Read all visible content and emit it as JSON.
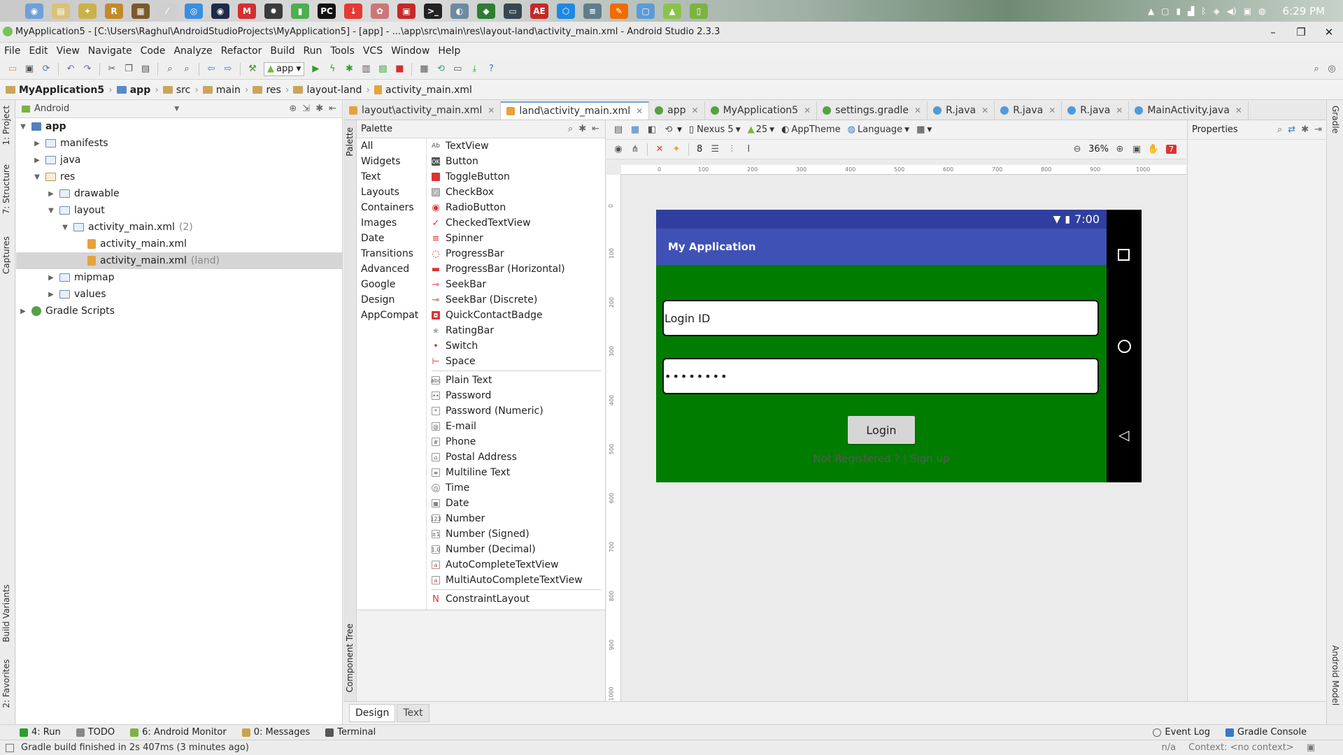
{
  "system": {
    "clock": "6:29 PM"
  },
  "window": {
    "title": "MyApplication5 - [C:\\Users\\Raghul\\AndroidStudioProjects\\MyApplication5] - [app] - ...\\app\\src\\main\\res\\layout-land\\activity_main.xml - Android Studio 2.3.3"
  },
  "menu": [
    "File",
    "Edit",
    "View",
    "Navigate",
    "Code",
    "Analyze",
    "Refactor",
    "Build",
    "Run",
    "Tools",
    "VCS",
    "Window",
    "Help"
  ],
  "toolbar": {
    "run_config": "app"
  },
  "breadcrumbs": [
    "MyApplication5",
    "app",
    "src",
    "main",
    "res",
    "layout-land",
    "activity_main.xml"
  ],
  "left_stripe": {
    "project": "1: Project",
    "structure": "7: Structure",
    "captures": "Captures",
    "build_variants": "Build Variants",
    "favorites": "2: Favorites"
  },
  "right_stripe": {
    "gradle": "Gradle",
    "android_model": "Android Model"
  },
  "project_panel": {
    "view": "Android",
    "tree": {
      "app": "app",
      "manifests": "manifests",
      "java": "java",
      "res": "res",
      "drawable": "drawable",
      "layout": "layout",
      "activity_main_group": "activity_main.xml",
      "activity_main_count": "(2)",
      "activity_main_xml": "activity_main.xml",
      "activity_main_land": "activity_main.xml",
      "land_qualifier": "(land)",
      "mipmap": "mipmap",
      "values": "values",
      "gradle_scripts": "Gradle Scripts"
    }
  },
  "editor_tabs": [
    {
      "label": "layout\\activity_main.xml"
    },
    {
      "label": "land\\activity_main.xml"
    },
    {
      "label": "app"
    },
    {
      "label": "MyApplication5"
    },
    {
      "label": "settings.gradle"
    },
    {
      "label": "R.java"
    },
    {
      "label": "R.java"
    },
    {
      "label": "R.java"
    },
    {
      "label": "MainActivity.java"
    }
  ],
  "palette": {
    "title": "Palette",
    "stripe_label": "Palette",
    "component_tree_label": "Component Tree",
    "categories": [
      "All",
      "Widgets",
      "Text",
      "Layouts",
      "Containers",
      "Images",
      "Date",
      "Transitions",
      "Advanced",
      "Google",
      "Design",
      "AppCompat"
    ],
    "widgets": [
      "TextView",
      "Button",
      "ToggleButton",
      "CheckBox",
      "RadioButton",
      "CheckedTextView",
      "Spinner",
      "ProgressBar",
      "ProgressBar (Horizontal)",
      "SeekBar",
      "SeekBar (Discrete)",
      "QuickContactBadge",
      "RatingBar",
      "Switch",
      "Space"
    ],
    "text_fields": [
      "Plain Text",
      "Password",
      "Password (Numeric)",
      "E-mail",
      "Phone",
      "Postal Address",
      "Multiline Text",
      "Time",
      "Date",
      "Number",
      "Number (Signed)",
      "Number (Decimal)",
      "AutoCompleteTextView",
      "MultiAutoCompleteTextView"
    ],
    "layouts": [
      "ConstraintLayout"
    ]
  },
  "design_toolbar": {
    "device": "Nexus 5",
    "api": "25",
    "theme": "AppTheme",
    "language": "Language",
    "margin": "8",
    "zoom": "36%",
    "warnings": "7"
  },
  "ruler": {
    "h": [
      "0",
      "100",
      "200",
      "300",
      "400",
      "500",
      "600",
      "700",
      "800",
      "900",
      "1000"
    ],
    "v": [
      "0",
      "100",
      "200",
      "300",
      "400",
      "500",
      "600",
      "700",
      "800",
      "900",
      "1000"
    ]
  },
  "device_preview": {
    "time": "7:00",
    "app_title": "My Application",
    "login_field": "Login ID",
    "password_field": "••••••••",
    "login_button": "Login",
    "signup_text": "Not Registered ? | Sign up",
    "colors": {
      "status": "#303f9f",
      "appbar": "#3f51b5",
      "background": "#007d00"
    }
  },
  "properties": {
    "title": "Properties"
  },
  "bottom_tabs": {
    "design": "Design",
    "text": "Text"
  },
  "tool_windows": [
    "4: Run",
    "TODO",
    "6: Android Monitor",
    "0: Messages",
    "Terminal"
  ],
  "tool_windows_right": [
    "Event Log",
    "Gradle Console"
  ],
  "status": {
    "message": "Gradle build finished in 2s 407ms (3 minutes ago)",
    "position": "n/a",
    "context": "Context: <no context>"
  }
}
